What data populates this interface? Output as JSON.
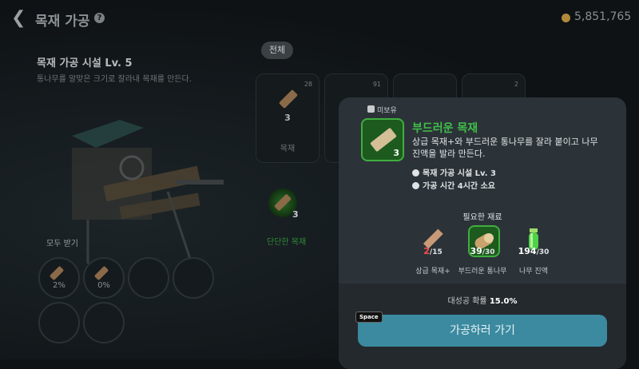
{
  "header": {
    "title": "목재 가공",
    "coins": "5,851,765"
  },
  "facility": {
    "name": "목재 가공 시설 Lv. 5",
    "description": "통나무를 알맞은 크기로 잘라내 목재를 만든다."
  },
  "receive_all": {
    "label": "모두 받기",
    "slots": [
      "2%",
      "0%"
    ]
  },
  "category": {
    "selected": "전체"
  },
  "cards": [
    {
      "count": "28",
      "qty": "3",
      "label": "목재"
    },
    {
      "count": "91",
      "qty": "",
      "label": ""
    },
    {
      "count": "",
      "qty": "",
      "label": ""
    },
    {
      "count": "2",
      "qty": "",
      "label": ""
    }
  ],
  "selected_card": {
    "qty": "3",
    "label": "단단한 목재"
  },
  "popup": {
    "owned": "미보유",
    "item": {
      "name": "부드러운 목재",
      "qty": "3",
      "description": "상급 목재+와 부드러운 통나무를 잘라 붙이고 나무 진액을 발라 만든다.",
      "facility": "목재 가공 시설 Lv. 3",
      "time": "가공 시간 4시간 소요"
    },
    "requirements_title": "필요한 재료",
    "materials": [
      {
        "have": "2",
        "need": "/15",
        "label": "상급 목재+",
        "insufficient": true
      },
      {
        "have": "39",
        "need": "/30",
        "label": "부드러운 통나무",
        "insufficient": false
      },
      {
        "have": "194",
        "need": "/30",
        "label": "나무 진액",
        "insufficient": false
      }
    ],
    "success_label": "대성공 확률",
    "success_value": "15.0%",
    "button_label": "가공하러 가기",
    "shortcut": "Space"
  },
  "colors": {
    "accent_green": "#3fbf4a",
    "button": "#3b8aa0",
    "insufficient": "#ff4d4d"
  }
}
